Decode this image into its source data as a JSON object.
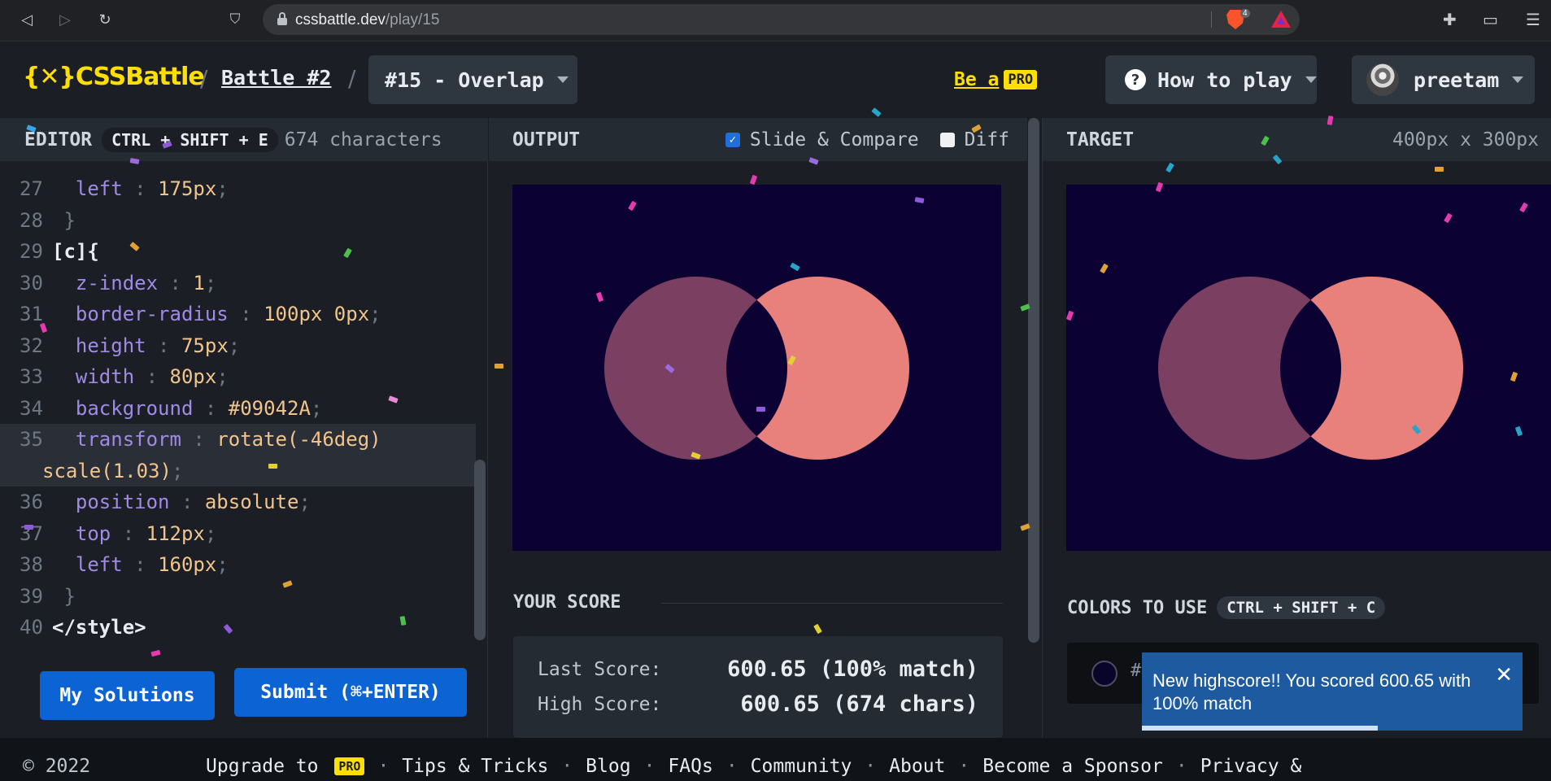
{
  "browser": {
    "url_host": "cssbattle.dev",
    "url_path": "/play/15",
    "brave_shield_count": "4"
  },
  "header": {
    "logo_text": "{✕}CSSBattle",
    "breadcrumb_sep": "/",
    "battle": "Battle #2",
    "target_select": "#15 - Overlap",
    "be_a": "Be a",
    "pro": "PRO",
    "how_to_play": "How to play",
    "user": "preetam"
  },
  "editor": {
    "title": "EDITOR",
    "shortcut": "CTRL + SHIFT + E",
    "char_count": "674 characters",
    "lines": [
      {
        "n": "27",
        "prop": "left",
        "val": "175px"
      },
      {
        "n": "28",
        "raw": "}"
      },
      {
        "n": "29",
        "raw": "[c]{"
      },
      {
        "n": "30",
        "prop": "z-index",
        "val": "1"
      },
      {
        "n": "31",
        "prop": "border-radius",
        "val": "100px 0px"
      },
      {
        "n": "32",
        "prop": "height",
        "val": "75px"
      },
      {
        "n": "33",
        "prop": "width",
        "val": "80px"
      },
      {
        "n": "34",
        "prop": "background",
        "val": "#09042A"
      },
      {
        "n": "35",
        "prop": "transform",
        "val": "rotate(-46deg)",
        "cont": "scale(1.03)"
      },
      {
        "n": "36",
        "prop": "position",
        "val": "absolute"
      },
      {
        "n": "37",
        "prop": "top",
        "val": "112px"
      },
      {
        "n": "38",
        "prop": "left",
        "val": "160px"
      },
      {
        "n": "39",
        "raw": "}"
      },
      {
        "n": "40",
        "raw": "</style>"
      }
    ],
    "my_solutions": "My Solutions",
    "submit": "Submit (⌘+ENTER)"
  },
  "output": {
    "title": "OUTPUT",
    "slide_compare": "Slide & Compare",
    "diff": "Diff",
    "your_score": "YOUR SCORE",
    "last_score_label": "Last Score:",
    "last_score_value": "600.65 (100% match)",
    "high_score_label": "High Score:",
    "high_score_value": "600.65 (674 chars)"
  },
  "target": {
    "title": "TARGET",
    "size": "400px x 300px",
    "colors_to_use": "COLORS TO USE",
    "colors_shortcut": "CTRL + SHIFT + C",
    "color_hex_visible": "#0"
  },
  "toast": {
    "message": "New highscore!! You scored 600.65 with 100% match",
    "progress": 0.62
  },
  "footer": {
    "copyright": "© 2022",
    "upgrade": "Upgrade to",
    "pro": "PRO",
    "links": [
      "Tips & Tricks",
      "Blog",
      "FAQs",
      "Community",
      "About",
      "Become a Sponsor",
      "Privacy &"
    ]
  },
  "colors": {
    "stage_bg": "#0b0233",
    "left_circle": "#7b3f61",
    "right_circle": "#e8817c",
    "accent_yellow": "#ffdf00",
    "button_blue": "#0b63d4"
  }
}
